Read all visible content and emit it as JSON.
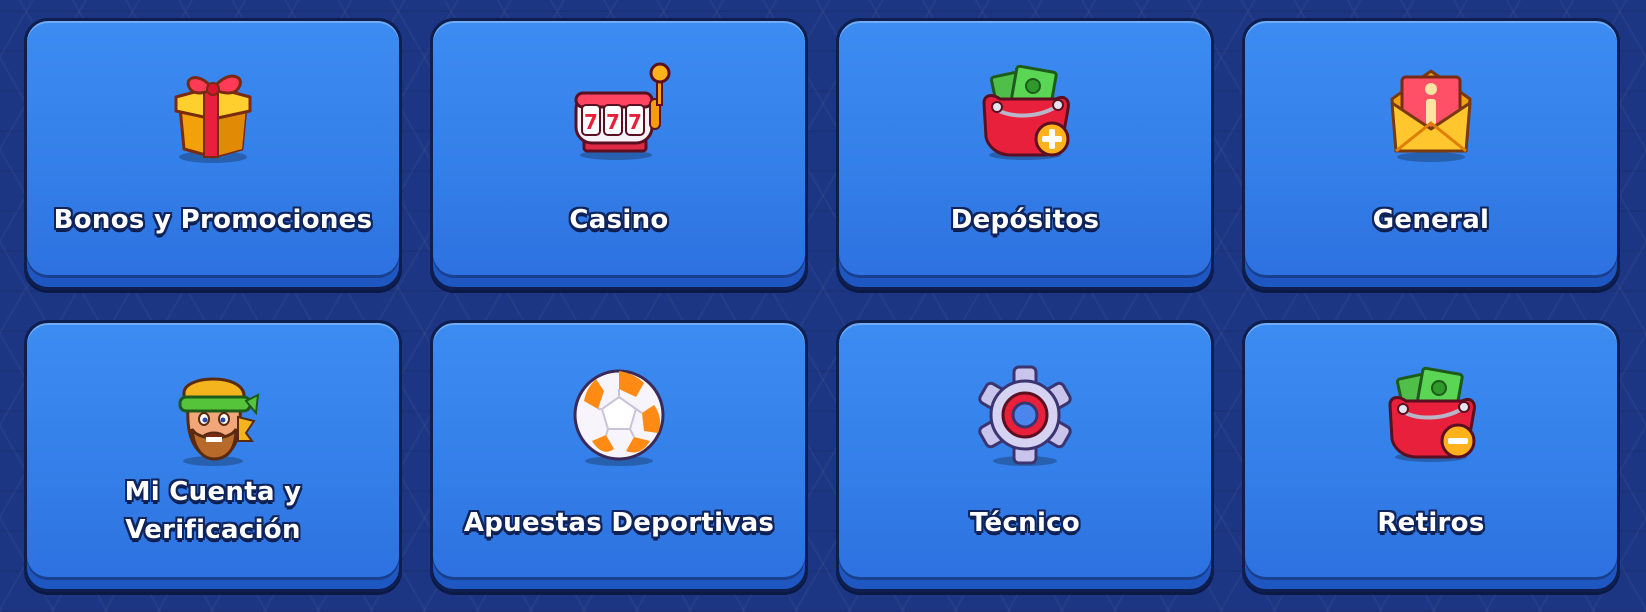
{
  "categories": [
    {
      "label": "Bonos y Promociones",
      "icon": "gift-icon"
    },
    {
      "label": "Casino",
      "icon": "slot-machine-icon"
    },
    {
      "label": "Depósitos",
      "icon": "wallet-deposit-icon"
    },
    {
      "label": "General",
      "icon": "info-envelope-icon"
    },
    {
      "label_line1": "Mi Cuenta y",
      "label_line2": "Verificación",
      "icon": "character-avatar-icon"
    },
    {
      "label": "Apuestas Deportivas",
      "icon": "soccer-ball-icon"
    },
    {
      "label": "Técnico",
      "icon": "gear-icon"
    },
    {
      "label": "Retiros",
      "icon": "wallet-withdraw-icon"
    }
  ],
  "colors": {
    "background": "#1d3683",
    "card": "#3c8cf2",
    "card_border": "#0d1e4f",
    "label_outline": "#10245c"
  }
}
